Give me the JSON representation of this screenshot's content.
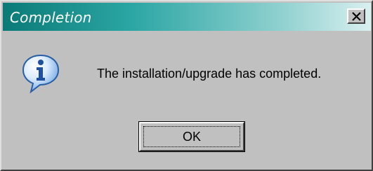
{
  "window": {
    "title": "Completion",
    "close_symbol": "✕",
    "title_gradient": [
      "#0b7a77",
      "#2ba6a4",
      "#8ed0cf",
      "#d9efef"
    ],
    "background": "#c0c0c0"
  },
  "dialog": {
    "icon": "info-icon",
    "message": "The installation/upgrade has completed.",
    "ok_label": "OK"
  }
}
